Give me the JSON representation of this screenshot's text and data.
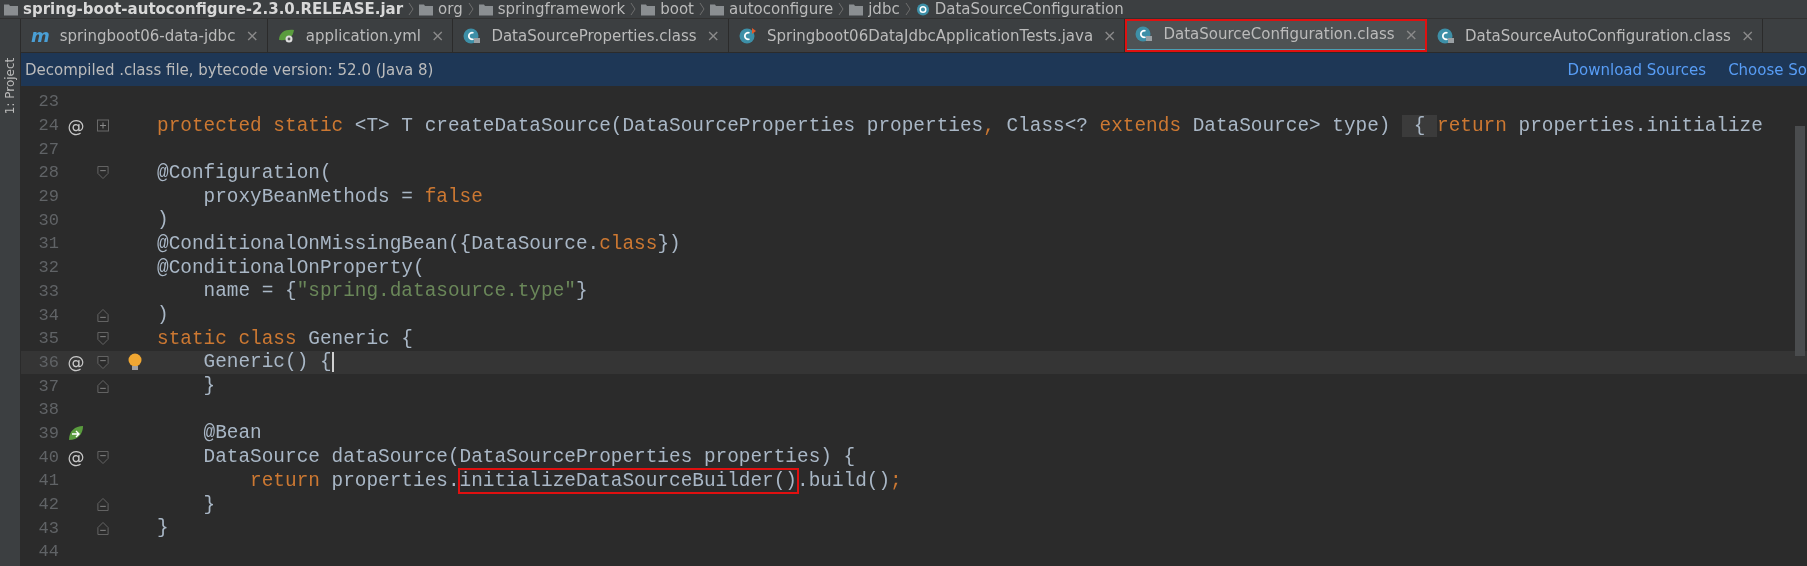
{
  "breadcrumb": [
    {
      "kind": "jar",
      "label": "spring-boot-autoconfigure-2.3.0.RELEASE.jar"
    },
    {
      "kind": "folder",
      "label": "org"
    },
    {
      "kind": "folder",
      "label": "springframework"
    },
    {
      "kind": "folder",
      "label": "boot"
    },
    {
      "kind": "folder",
      "label": "autoconfigure"
    },
    {
      "kind": "folder",
      "label": "jdbc"
    },
    {
      "kind": "class",
      "label": "DataSourceConfiguration"
    }
  ],
  "side_tool": {
    "label": "1: Project"
  },
  "tabs": [
    {
      "kind": "maven",
      "glyph": "m",
      "label": "springboot06-data-jdbc",
      "close": "×",
      "selected": false,
      "marked": false
    },
    {
      "kind": "yml",
      "label": "application.yml",
      "close": "×",
      "selected": false,
      "marked": false
    },
    {
      "kind": "class",
      "label": "DataSourceProperties.class",
      "close": "×",
      "selected": false,
      "marked": false
    },
    {
      "kind": "test",
      "label": "Springboot06DataJdbcApplicationTests.java",
      "close": "×",
      "selected": false,
      "marked": false
    },
    {
      "kind": "class",
      "label": "DataSourceConfiguration.class",
      "close": "×",
      "selected": true,
      "marked": true
    },
    {
      "kind": "class",
      "label": "DataSourceAutoConfiguration.class",
      "close": "×",
      "selected": false,
      "marked": false
    }
  ],
  "banner": {
    "text": "Decompiled .class file, bytecode version: 52.0 (Java 8)",
    "links": [
      "Download Sources",
      "Choose So"
    ]
  },
  "code": [
    {
      "number": "23",
      "current": false
    },
    {
      "number": "24",
      "gutter_text": "@",
      "fold": {
        "kind": "plus"
      },
      "current": false,
      "segments": [
        {
          "kind": "kw",
          "text": "protected static "
        },
        {
          "kind": "plain",
          "text": "<T> T createDataSource(DataSourceProperties properties"
        },
        {
          "kind": "kw",
          "text": ", "
        },
        {
          "kind": "plain",
          "text": "Class<? "
        },
        {
          "kind": "kw",
          "text": "extends "
        },
        {
          "kind": "plain",
          "text": "DataSource> type) "
        },
        {
          "kind": "fold",
          "text": " { "
        },
        {
          "kind": "kw",
          "text": "return "
        },
        {
          "kind": "plain",
          "text": "properties.initialize"
        }
      ]
    },
    {
      "number": "27",
      "current": false
    },
    {
      "number": "28",
      "fold": {
        "kind": "open"
      },
      "current": false,
      "segments": [
        {
          "kind": "plain",
          "text": "@Configuration("
        }
      ]
    },
    {
      "number": "29",
      "current": false,
      "segments": [
        {
          "kind": "plain",
          "text": "    proxyBeanMethods = "
        },
        {
          "kind": "kw",
          "text": "false"
        }
      ]
    },
    {
      "number": "30",
      "current": false,
      "segments": [
        {
          "kind": "plain",
          "text": ")"
        }
      ]
    },
    {
      "number": "31",
      "current": false,
      "segments": [
        {
          "kind": "plain",
          "text": "@ConditionalOnMissingBean({DataSource."
        },
        {
          "kind": "kw",
          "text": "class"
        },
        {
          "kind": "plain",
          "text": "})"
        }
      ]
    },
    {
      "number": "32",
      "current": false,
      "segments": [
        {
          "kind": "plain",
          "text": "@ConditionalOnProperty("
        }
      ]
    },
    {
      "number": "33",
      "current": false,
      "segments": [
        {
          "kind": "plain",
          "text": "    name = {"
        },
        {
          "kind": "str",
          "text": "\"spring.datasource.type\""
        },
        {
          "kind": "plain",
          "text": "}"
        }
      ]
    },
    {
      "number": "34",
      "fold": {
        "kind": "close"
      },
      "current": false,
      "segments": [
        {
          "kind": "plain",
          "text": ")"
        }
      ]
    },
    {
      "number": "35",
      "fold": {
        "kind": "open"
      },
      "current": false,
      "segments": [
        {
          "kind": "kw",
          "text": "static class "
        },
        {
          "kind": "plain",
          "text": "Generic {"
        }
      ]
    },
    {
      "number": "36",
      "gutter_text": "@",
      "fold": {
        "kind": "open"
      },
      "bulb": true,
      "current": true,
      "segments": [
        {
          "kind": "plain",
          "text": "    Generic() {"
        }
      ]
    },
    {
      "number": "37",
      "fold": {
        "kind": "close"
      },
      "current": false,
      "segments": [
        {
          "kind": "plain",
          "text": "    }"
        }
      ]
    },
    {
      "number": "38",
      "current": false
    },
    {
      "number": "39",
      "bean": true,
      "current": false,
      "segments": [
        {
          "kind": "plain",
          "text": "    @Bean"
        }
      ]
    },
    {
      "number": "40",
      "gutter_text": "@",
      "fold": {
        "kind": "open"
      },
      "current": false,
      "segments": [
        {
          "kind": "plain",
          "text": "    DataSource dataSource(DataSourceProperties properties) {"
        }
      ]
    },
    {
      "number": "41",
      "current": false,
      "segments": [
        {
          "kind": "kw",
          "text": "        return "
        },
        {
          "kind": "plain",
          "text": "properties."
        },
        {
          "kind": "boxed",
          "text": "initializeDataSourceBuilder()"
        },
        {
          "kind": "plain",
          "text": ".build()"
        },
        {
          "kind": "kw",
          "text": ";"
        }
      ]
    },
    {
      "number": "42",
      "fold": {
        "kind": "close"
      },
      "current": false,
      "segments": [
        {
          "kind": "plain",
          "text": "    }"
        }
      ]
    },
    {
      "number": "43",
      "fold": {
        "kind": "close"
      },
      "current": false,
      "segments": [
        {
          "kind": "plain",
          "text": "}"
        }
      ]
    },
    {
      "number": "44",
      "current": false
    }
  ]
}
